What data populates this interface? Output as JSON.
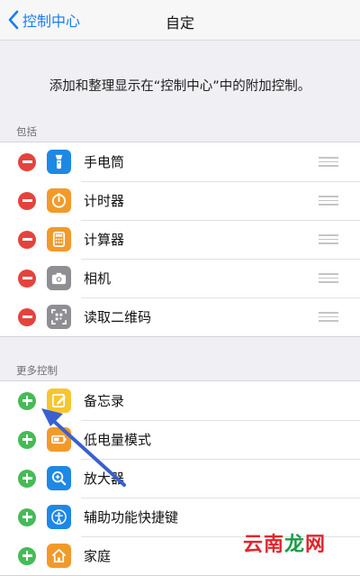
{
  "nav": {
    "back_label": "控制中心",
    "title": "自定"
  },
  "intro": "添加和整理显示在“控制中心”中的附加控制。",
  "included": {
    "header": "包括",
    "items": [
      {
        "label": "手电筒",
        "icon": "flashlight-icon",
        "color": "#1e88e5"
      },
      {
        "label": "计时器",
        "icon": "timer-icon",
        "color": "#f29a29"
      },
      {
        "label": "计算器",
        "icon": "calculator-icon",
        "color": "#f29a29"
      },
      {
        "label": "相机",
        "icon": "camera-icon",
        "color": "#8e8e93"
      },
      {
        "label": "读取二维码",
        "icon": "qr-code-icon",
        "color": "#8e8e93"
      }
    ]
  },
  "more": {
    "header": "更多控制",
    "items": [
      {
        "label": "备忘录",
        "icon": "notes-icon",
        "color": "#f7c52f"
      },
      {
        "label": "低电量模式",
        "icon": "battery-icon",
        "color": "#f29a29"
      },
      {
        "label": "放大器",
        "icon": "magnifier-icon",
        "color": "#1e88e5"
      },
      {
        "label": "辅助功能快捷键",
        "icon": "accessibility-icon",
        "color": "#1e88e5"
      },
      {
        "label": "家庭",
        "icon": "home-icon",
        "color": "#f29a29"
      }
    ]
  },
  "watermark": {
    "c1": "云",
    "c2": "南",
    "c3": "龙",
    "c4": "网"
  },
  "colors": {
    "accent": "#1a7cf2",
    "remove": "#e4433d",
    "add": "#45bb56",
    "annotation_arrow": "#3a5fd0",
    "watermark_red": "#e0262c",
    "watermark_green": "#1f9a45"
  }
}
